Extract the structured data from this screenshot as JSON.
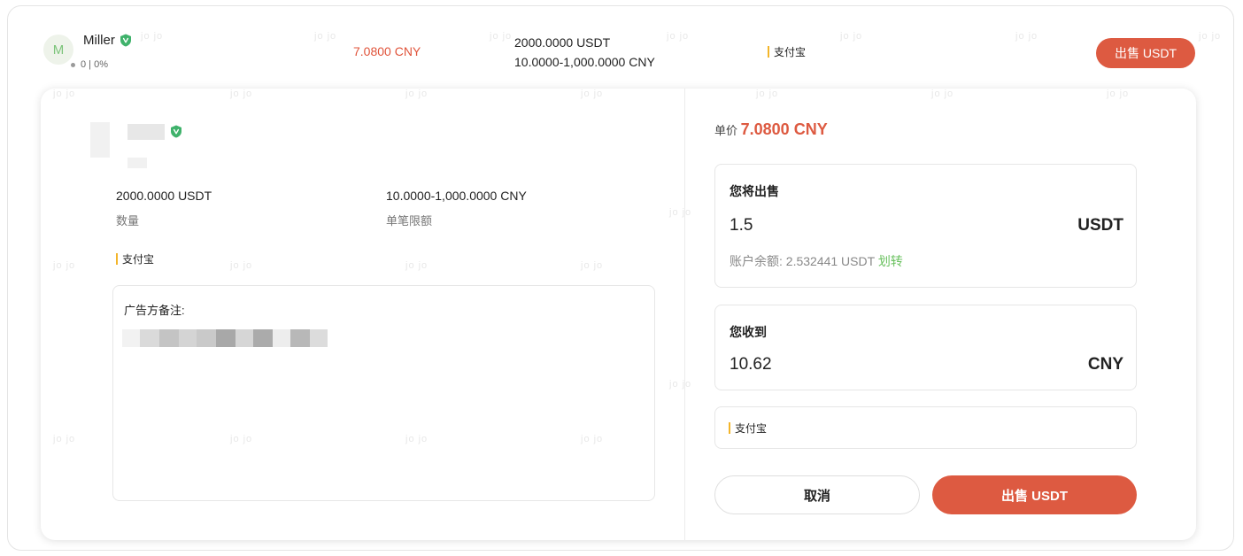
{
  "watermark_text": "jo jo",
  "listing": {
    "avatar_letter": "M",
    "trader_name": "Miller",
    "trader_stats": "0 | 0%",
    "price": "7.0800 CNY",
    "available": "2000.0000 USDT",
    "limit": "10.0000-1,000.0000 CNY",
    "payment": "支付宝",
    "sell_button": "出售 USDT"
  },
  "details": {
    "quantity_value": "2000.0000 USDT",
    "quantity_label": "数量",
    "limit_value": "10.0000-1,000.0000 CNY",
    "limit_label": "单笔限额",
    "payment": "支付宝",
    "notes_title": "广告方备注:"
  },
  "order": {
    "unit_price_label": "单价",
    "unit_price_value": "7.0800 CNY",
    "sell_title": "您将出售",
    "sell_amount": "1.5",
    "sell_unit": "USDT",
    "balance_label": "账户余额: 2.532441 USDT",
    "transfer_link": "划转",
    "receive_title": "您收到",
    "receive_amount": "10.62",
    "receive_unit": "CNY",
    "payment_method": "支付宝",
    "cancel_button": "取消",
    "confirm_button": "出售 USDT"
  },
  "colors": {
    "accent_red": "#dd5a41",
    "verified_green": "#3fb26b",
    "link_green": "#6ac15f",
    "payment_bar": "#f3b52a"
  }
}
